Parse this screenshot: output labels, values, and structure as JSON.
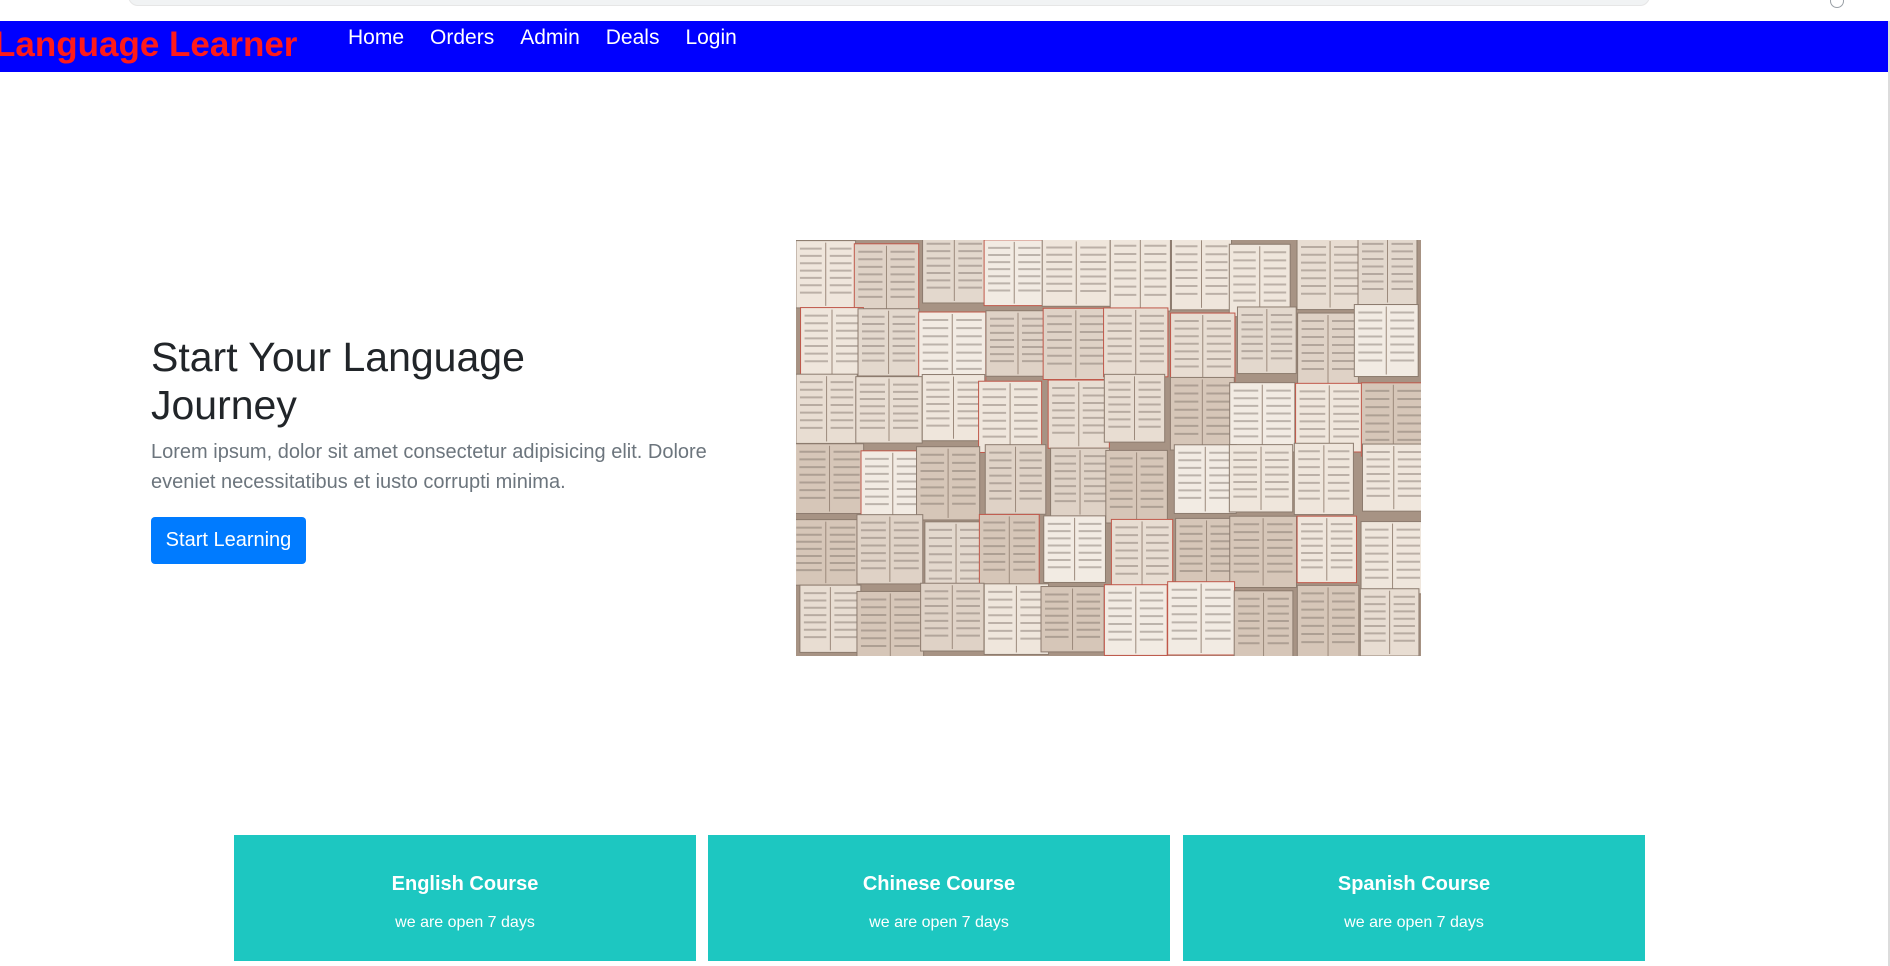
{
  "navbar": {
    "brand": "Language Learner",
    "links": [
      "Home",
      "Orders",
      "Admin",
      "Deals",
      "Login"
    ]
  },
  "hero": {
    "title": "Start Your Language Journey",
    "text": "Lorem ipsum, dolor sit amet consectetur adipisicing elit. Dolore eveniet necessitatibus et iusto corrupti minima.",
    "button_label": "Start Learning",
    "image_subject": "open-books-pages-photo"
  },
  "courses": [
    {
      "title": "English Course",
      "subtitle": "we are open 7 days"
    },
    {
      "title": "Chinese Course",
      "subtitle": "we are open 7 days"
    },
    {
      "title": "Spanish Course",
      "subtitle": "we are open 7 days"
    }
  ],
  "colors": {
    "navbar_bg": "#0000ff",
    "brand_text": "#ff1a1a",
    "primary_button": "#007bff",
    "course_card_bg": "#1dc7c1"
  }
}
